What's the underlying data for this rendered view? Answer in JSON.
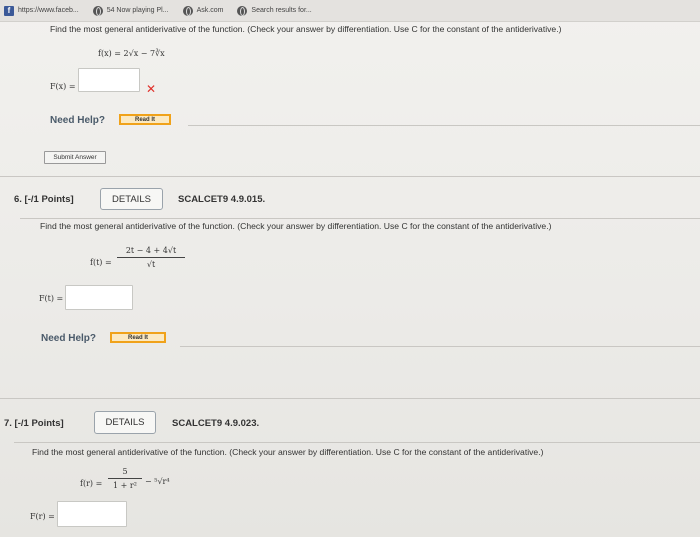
{
  "bookmarks": [
    {
      "label": "https://www.faceb...",
      "icon": "facebook-icon"
    },
    {
      "label": "54 Now playing Pl...",
      "icon": "globe-icon"
    },
    {
      "label": "Ask.com",
      "icon": "globe-icon"
    },
    {
      "label": "Search results for...",
      "icon": "globe-icon"
    }
  ],
  "q5": {
    "prompt": "Find the most general antiderivative of the function. (Check your answer by differentiation. Use C for the constant of the antiderivative.)",
    "function": "f(x) = 2√x − 7∛x",
    "answer_label": "F(x) =",
    "answer_value": "",
    "status_mark": "✕",
    "need_help": "Need Help?",
    "read_it": "Read It",
    "submit": "Submit Answer"
  },
  "q6": {
    "number": "6.  [-/1 Points]",
    "details": "DETAILS",
    "code": "SCALCET9 4.9.015.",
    "prompt": "Find the most general antiderivative of the function. (Check your answer by differentiation. Use C for the constant of the antiderivative.)",
    "fn_label": "f(t) =",
    "numerator": "2t − 4 + 4√t",
    "denominator": "√t",
    "answer_label": "F(t) =",
    "answer_value": "",
    "need_help": "Need Help?",
    "read_it": "Read It"
  },
  "q7": {
    "number": "7.  [-/1 Points]",
    "details": "DETAILS",
    "code": "SCALCET9 4.9.023.",
    "prompt": "Find the most general antiderivative of the function. (Check your answer by differentiation. Use C for the constant of the antiderivative.)",
    "fn_label": "f(r) =",
    "numerator": "5",
    "denominator": "1 + r²",
    "tail": "− ⁵√r⁴",
    "answer_label": "F(r) =",
    "answer_value": ""
  },
  "colors": {
    "accent_orange": "#f0a21a",
    "error_red": "#e0302a",
    "help_blue": "#4a5a6a"
  }
}
